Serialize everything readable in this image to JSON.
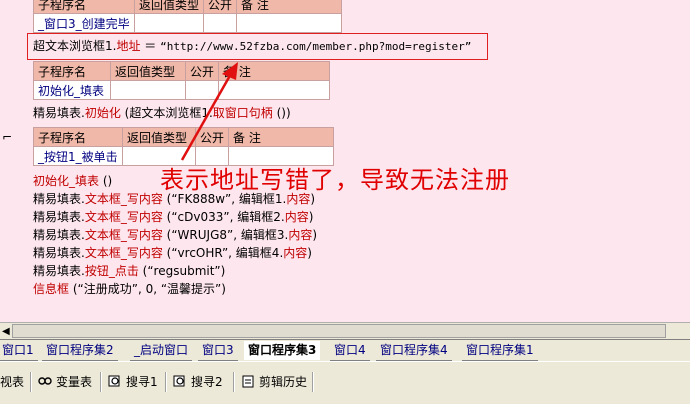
{
  "tables": {
    "t1": {
      "headers": [
        "子程序名",
        "返回值类型",
        "公开",
        "备 注"
      ],
      "row": "_窗口3_创建完毕"
    },
    "t2": {
      "headers": [
        "子程序名",
        "返回值类型",
        "公开",
        "备 注"
      ],
      "row": "初始化_填表"
    },
    "t3": {
      "headers": [
        "子程序名",
        "返回值类型",
        "公开",
        "备 注"
      ],
      "row": "_按钮1_被单击"
    }
  },
  "code": {
    "url_line": {
      "obj": "超文本浏览框1.",
      "prop": "地址",
      "eq": " ＝ ",
      "value": "“http://www.52fzba.com/member.php?mod=register”"
    },
    "init_line": {
      "obj": "精易填表.",
      "method": "初始化",
      "args_open": " (超文本浏览框1.",
      "method2": "取窗口句柄",
      "args_close": " ())"
    },
    "call_line": {
      "name": "初始化_填表",
      "args": " ()"
    },
    "writes": [
      {
        "obj": "精易填表.",
        "method": "文本框_写内容",
        "args_open": " (“FK888w”, 编辑框1.",
        "prop": "内容",
        "args_close": ")"
      },
      {
        "obj": "精易填表.",
        "method": "文本框_写内容",
        "args_open": " (“cDv033”, 编辑框2.",
        "prop": "内容",
        "args_close": ")"
      },
      {
        "obj": "精易填表.",
        "method": "文本框_写内容",
        "args_open": " (“WRUJG8”, 编辑框3.",
        "prop": "内容",
        "args_close": ")"
      },
      {
        "obj": "精易填表.",
        "method": "文本框_写内容",
        "args_open": " (“vrcOHR”, 编辑框4.",
        "prop": "内容",
        "args_close": ")"
      }
    ],
    "click_line": {
      "obj": "精易填表.",
      "method": "按钮_点击",
      "args": " (“regsubmit”)"
    },
    "msg_line": {
      "name": "信息框",
      "args": " (“注册成功”, 0, “温馨提示”)"
    }
  },
  "annotation": "表示地址写错了，导致无法注册",
  "tabs": [
    {
      "label": "窗口1"
    },
    {
      "label": "窗口程序集2"
    },
    {
      "label": "_启动窗口"
    },
    {
      "label": "窗口3"
    },
    {
      "label": "窗口程序集3"
    },
    {
      "label": "窗口4"
    },
    {
      "label": "窗口程序集4"
    },
    {
      "label": "窗口程序集1"
    }
  ],
  "toolbar": [
    {
      "label": "视表",
      "icon": "table-icon"
    },
    {
      "label": "变量表",
      "icon": "variables-icon"
    },
    {
      "label": "搜寻1",
      "icon": "search-icon"
    },
    {
      "label": "搜寻2",
      "icon": "search-icon"
    },
    {
      "label": "剪辑历史",
      "icon": "clipboard-icon"
    }
  ],
  "colors": {
    "editor_bg": "#fde6ee",
    "header_bg": "#f0b8a8",
    "keyword_red": "#c00000",
    "method_blue": "#0000cc",
    "annotation_red": "#e00000"
  }
}
